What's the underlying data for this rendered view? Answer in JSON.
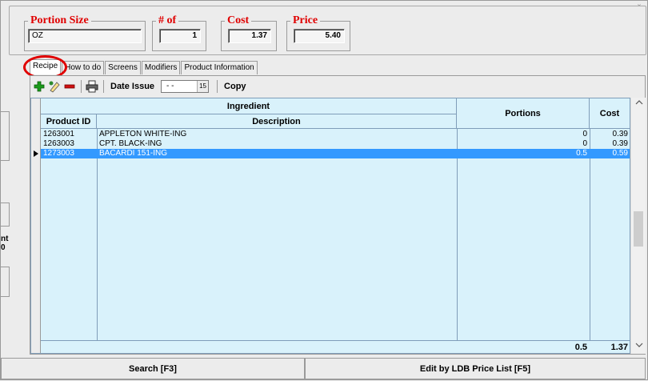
{
  "window": {
    "close_glyph": "x"
  },
  "header": {
    "portion_size": {
      "title": "Portion Size",
      "value": "OZ"
    },
    "count": {
      "title": "# of",
      "value": "1"
    },
    "cost": {
      "title": "Cost",
      "value": "1.37"
    },
    "price": {
      "title": "Price",
      "value": "5.40"
    }
  },
  "left_strip": {
    "fragment1": "nt",
    "fragment2": "0"
  },
  "tabs": [
    {
      "label": "Recipe",
      "active": true
    },
    {
      "label": "How to do"
    },
    {
      "label": "Screens"
    },
    {
      "label": "Modifiers"
    },
    {
      "label": "Product Information"
    }
  ],
  "toolbar": {
    "add_icon": "add-icon",
    "edit_icon": "edit-icon",
    "remove_icon": "remove-icon",
    "print_icon": "print-icon",
    "date_label": "Date Issue",
    "date_value": "- -",
    "calendar_glyph": "15",
    "copy_label": "Copy"
  },
  "grid": {
    "group_header": "Ingredient",
    "columns": {
      "product_id": "Product ID",
      "description": "Description",
      "portions": "Portions",
      "cost": "Cost"
    },
    "rows": [
      {
        "product_id": "1263001",
        "description": "APPLETON WHITE-ING",
        "portions": "0",
        "cost": "0.39",
        "selected": false
      },
      {
        "product_id": "1263003",
        "description": "CPT. BLACK-ING",
        "portions": "0",
        "cost": "0.39",
        "selected": false
      },
      {
        "product_id": "1273003",
        "description": "BACARDI 151-ING",
        "portions": "0.5",
        "cost": "0.59",
        "selected": true
      }
    ],
    "totals": {
      "portions": "0.5",
      "cost": "1.37"
    }
  },
  "footer": {
    "search_label": "Search [F3]",
    "edit_label": "Edit by LDB Price List [F5]"
  },
  "colors": {
    "accent_red": "#e00000",
    "grid_bg": "#d9f2fb",
    "selection": "#3399ff"
  }
}
